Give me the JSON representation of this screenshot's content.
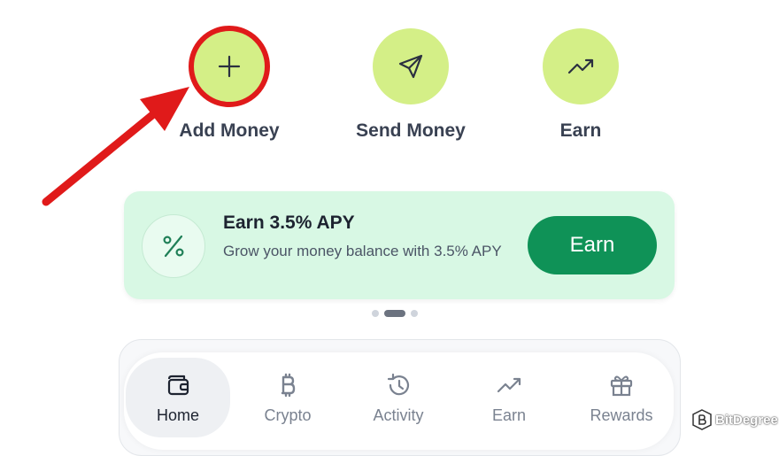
{
  "actions": {
    "add_label": "Add Money",
    "send_label": "Send Money",
    "earn_label": "Earn"
  },
  "promo": {
    "title": "Earn 3.5% APY",
    "description": "Grow your money balance with 3.5% APY",
    "button_label": "Earn"
  },
  "carousel": {
    "pages": 3,
    "active_index": 1
  },
  "nav": {
    "items": [
      {
        "label": "Home",
        "icon": "wallet-icon",
        "active": true
      },
      {
        "label": "Crypto",
        "icon": "bitcoin-icon",
        "active": false
      },
      {
        "label": "Activity",
        "icon": "history-icon",
        "active": false
      },
      {
        "label": "Earn",
        "icon": "trending-up-icon",
        "active": false
      },
      {
        "label": "Rewards",
        "icon": "gift-icon",
        "active": false
      }
    ]
  },
  "watermark": {
    "text": "BitDegree"
  },
  "colors": {
    "action_circle": "#d4ef87",
    "highlight_red": "#e01a1a",
    "promo_bg": "#d8f8e4",
    "earn_button": "#0f9257"
  }
}
